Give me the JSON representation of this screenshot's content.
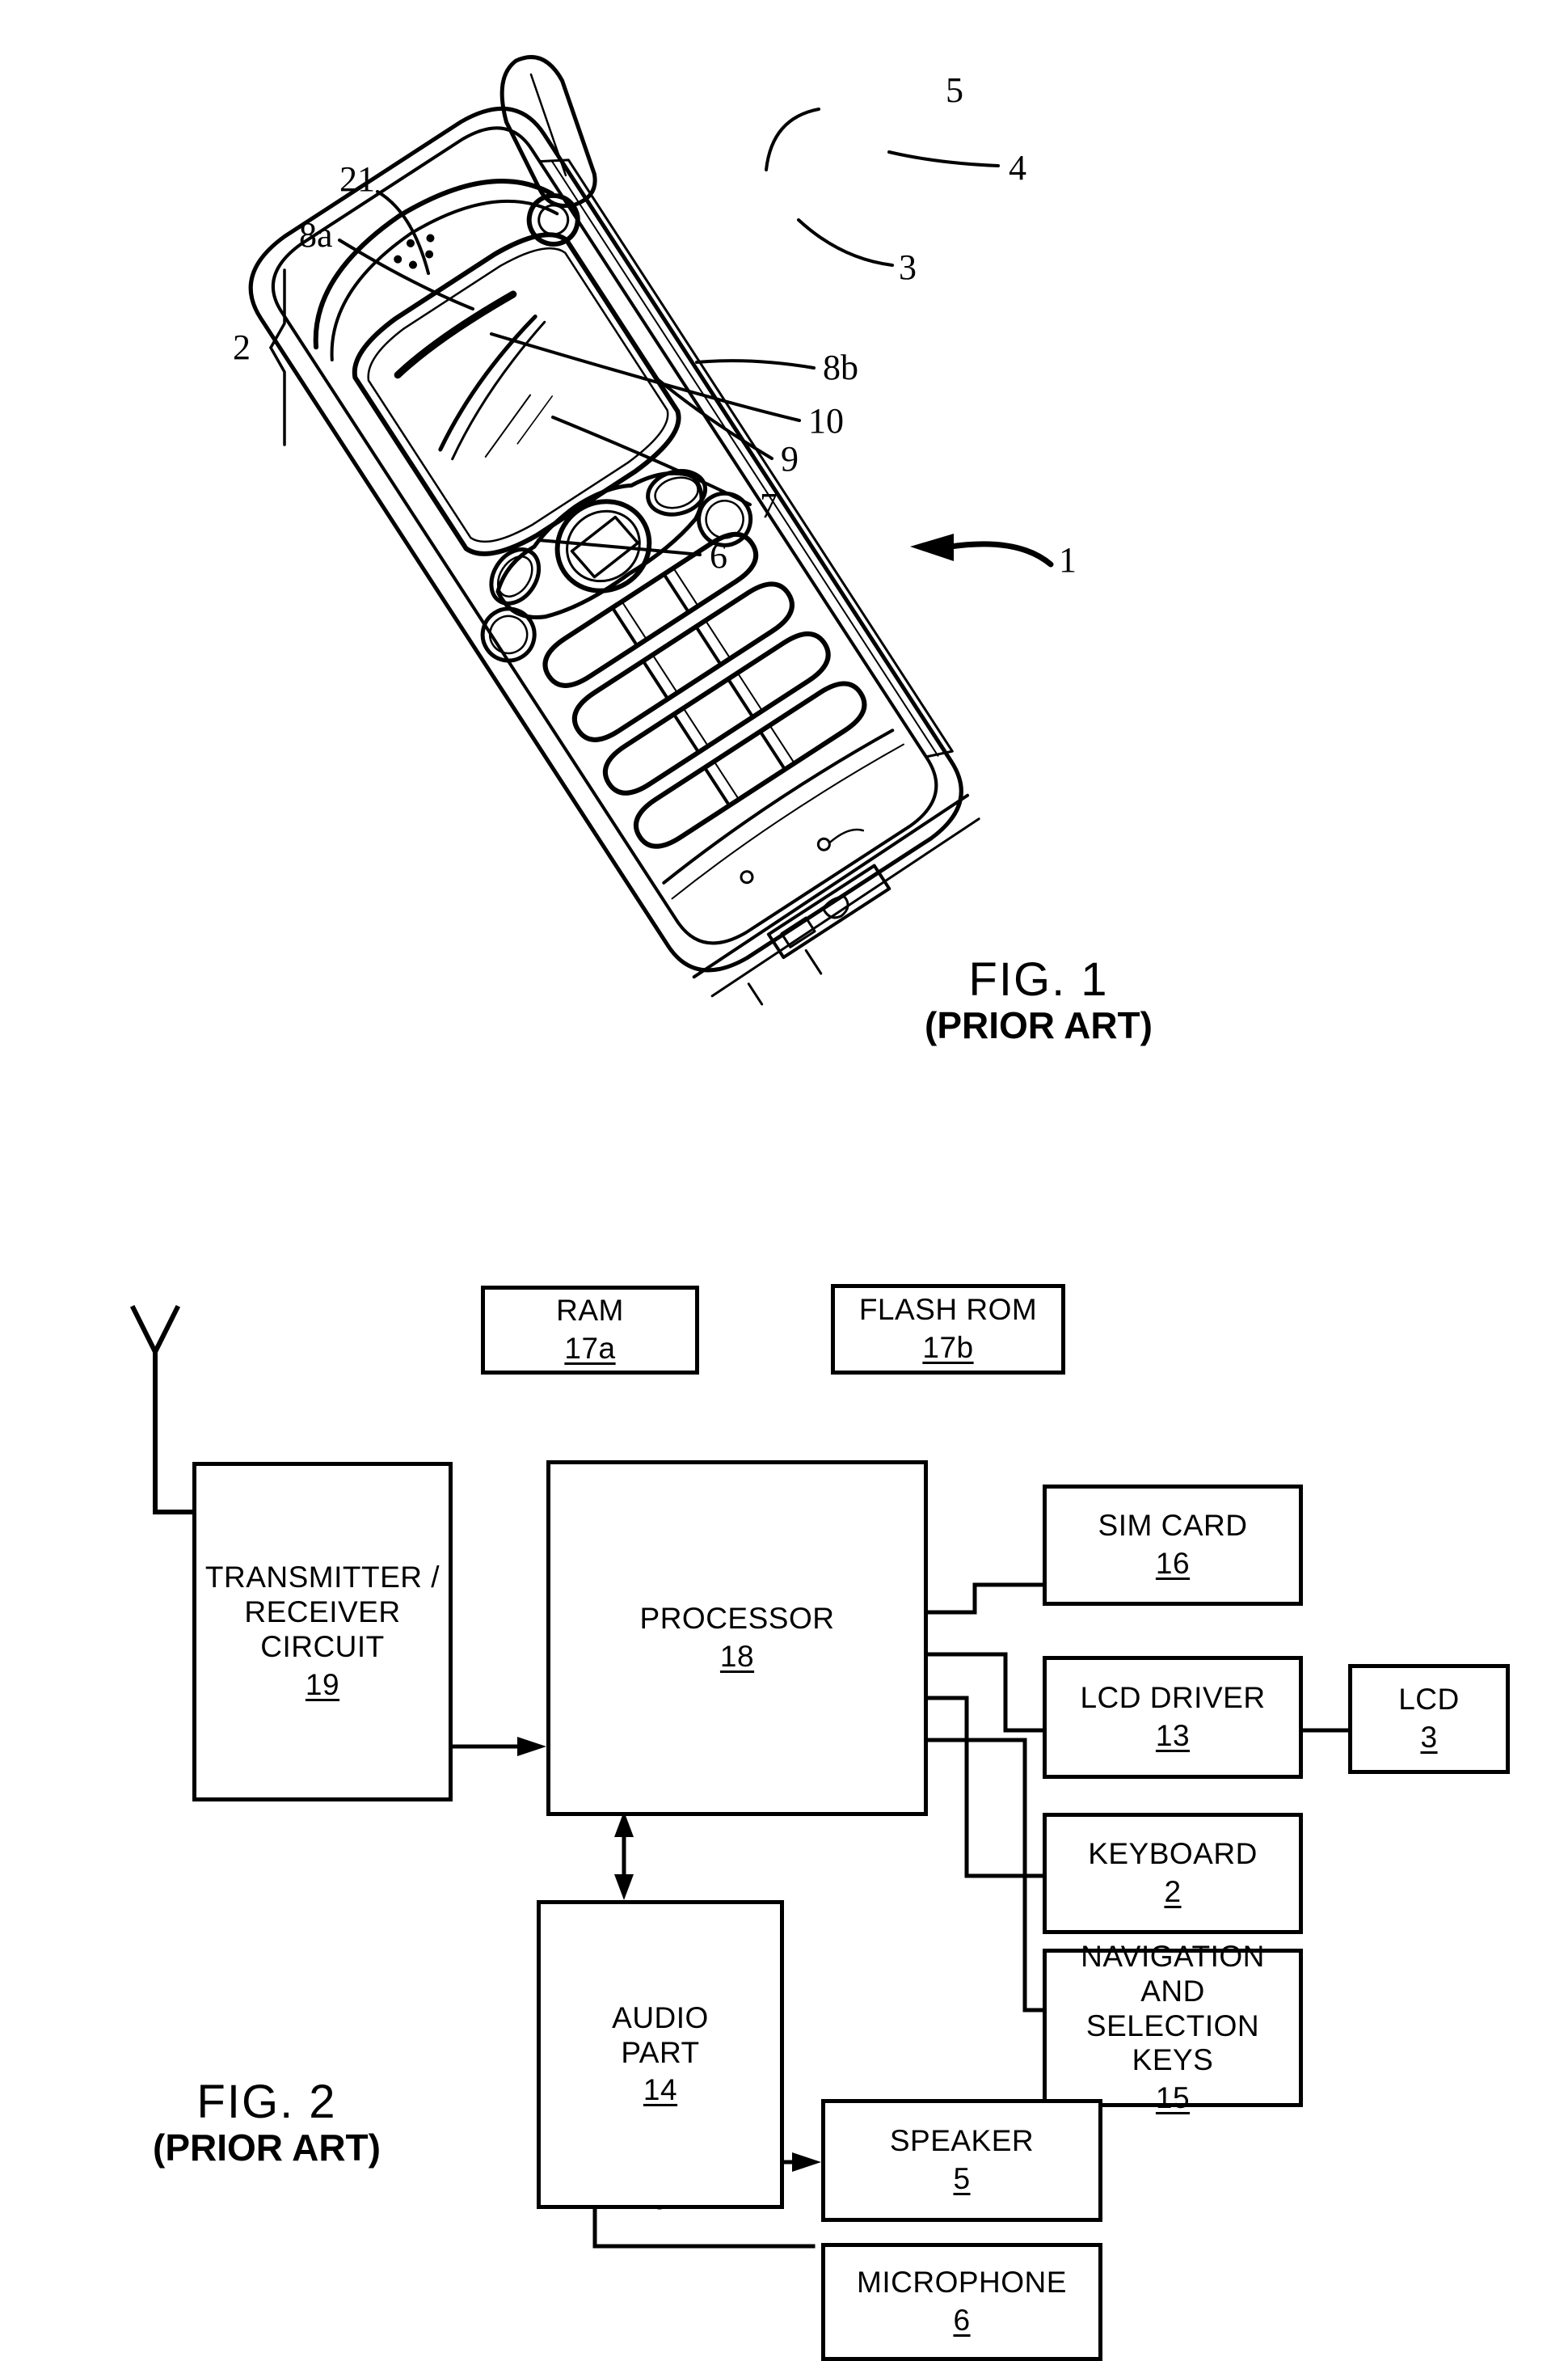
{
  "document": {
    "type": "patent-drawing-sheet",
    "figures": [
      {
        "id": "fig1",
        "caption_title": "FIG. 1",
        "caption_sub": "(PRIOR ART)",
        "subject": "mobile telephone perspective view",
        "reference_numerals": [
          {
            "label": "5",
            "meaning": "speaker"
          },
          {
            "label": "4",
            "meaning": "antenna"
          },
          {
            "label": "21",
            "meaning": "display frame edge"
          },
          {
            "label": "8a",
            "meaning": "left soft key"
          },
          {
            "label": "3",
            "meaning": "display / LCD"
          },
          {
            "label": "1",
            "meaning": "mobile telephone"
          },
          {
            "label": "2",
            "meaning": "keyboard"
          },
          {
            "label": "8b",
            "meaning": "right soft key"
          },
          {
            "label": "10",
            "meaning": "navigation key"
          },
          {
            "label": "9",
            "meaning": "selection key"
          },
          {
            "label": "7",
            "meaning": "keypad key"
          },
          {
            "label": "6",
            "meaning": "microphone"
          }
        ]
      },
      {
        "id": "fig2",
        "caption_title": "FIG. 2",
        "caption_sub": "(PRIOR ART)",
        "subject": "block diagram of mobile telephone circuitry",
        "blocks": [
          {
            "key": "ram",
            "label": "RAM",
            "num": "17a"
          },
          {
            "key": "flash_rom",
            "label": "FLASH ROM",
            "num": "17b"
          },
          {
            "key": "transceiver",
            "label": "TRANSMITTER /\nRECEIVER\nCIRCUIT",
            "num": "19"
          },
          {
            "key": "processor",
            "label": "PROCESSOR",
            "num": "18"
          },
          {
            "key": "sim_card",
            "label": "SIM CARD",
            "num": "16"
          },
          {
            "key": "lcd_driver",
            "label": "LCD DRIVER",
            "num": "13"
          },
          {
            "key": "lcd",
            "label": "LCD",
            "num": "3"
          },
          {
            "key": "keyboard",
            "label": "KEYBOARD",
            "num": "2"
          },
          {
            "key": "nav_keys",
            "label": "NAVIGATION AND\nSELECTION KEYS",
            "num": "15"
          },
          {
            "key": "audio_part",
            "label": "AUDIO\nPART",
            "num": "14"
          },
          {
            "key": "speaker",
            "label": "SPEAKER",
            "num": "5"
          },
          {
            "key": "microphone",
            "label": "MICROPHONE",
            "num": "6"
          }
        ],
        "antenna_symbol": "Y"
      }
    ]
  },
  "colors": {
    "ink": "#000000",
    "paper": "#ffffff"
  }
}
